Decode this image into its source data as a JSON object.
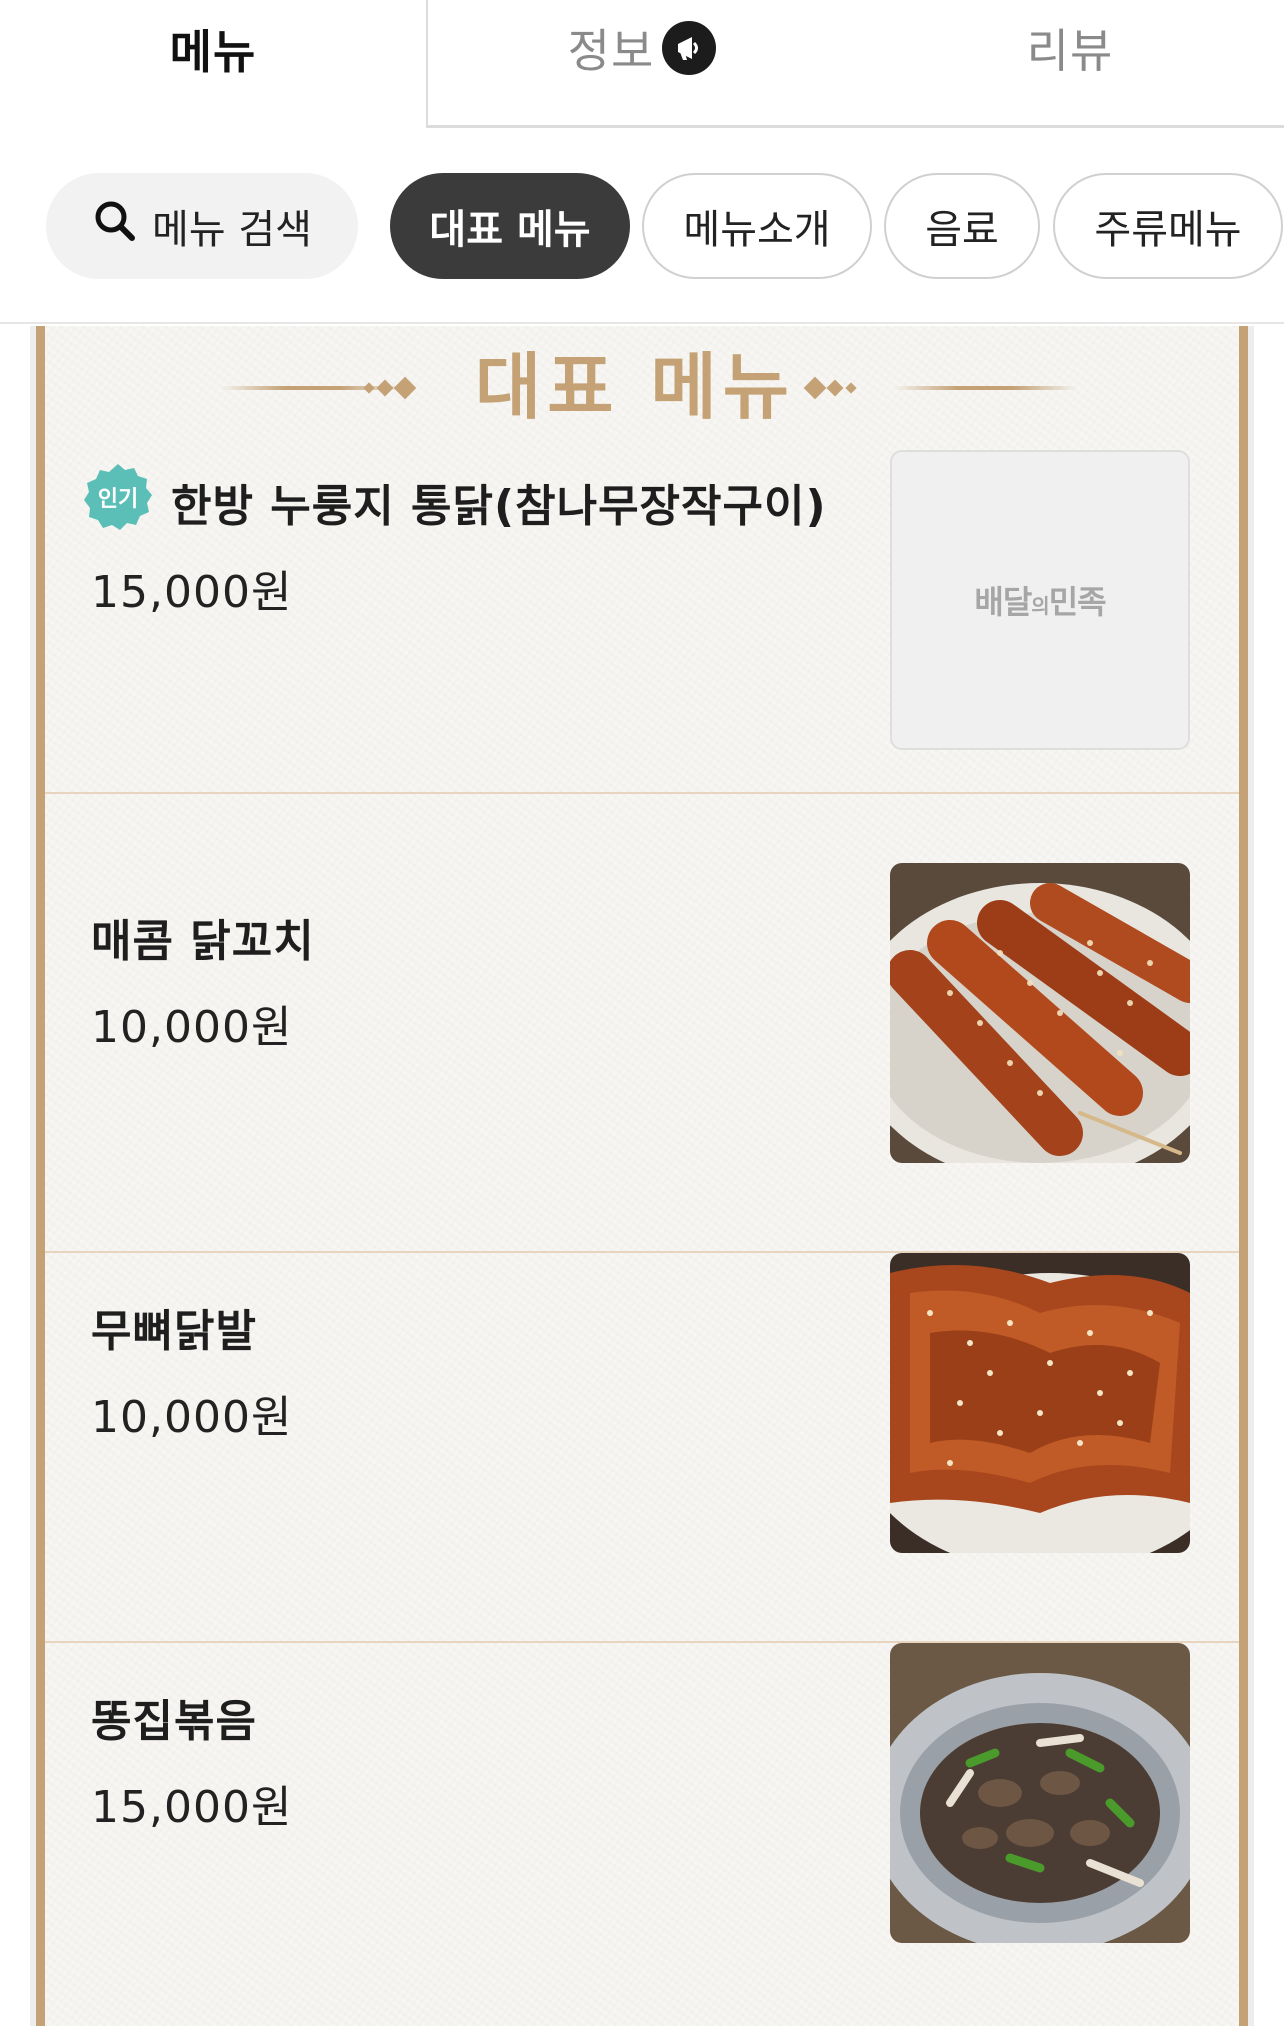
{
  "tabs": {
    "menu": "메뉴",
    "info": "정보",
    "review": "리뷰"
  },
  "chips": {
    "search": "메뉴 검색",
    "signature": "대표 메뉴",
    "intro": "메뉴소개",
    "drink": "음료",
    "alcohol": "주류메뉴"
  },
  "section": {
    "title": "대표 메뉴"
  },
  "items": [
    {
      "badge": "인기",
      "name": "한방 누룽지 통닭(참나무장작구이)",
      "price": "15,000원",
      "image": "placeholder"
    },
    {
      "name": "매콤 닭꼬치",
      "price": "10,000원",
      "image": "spicy-chicken-skewers"
    },
    {
      "name": "무뼈닭발",
      "price": "10,000원",
      "image": "boneless-chicken-feet"
    },
    {
      "name": "똥집볶음",
      "price": "15,000원",
      "image": "stir-fried-gizzards"
    }
  ],
  "placeholder_brand": {
    "left": "배달",
    "small": "의",
    "right": "민족"
  },
  "colors": {
    "accent": "#c4a276",
    "badge": "#5bbfb8",
    "chip_active": "#3b3b3b"
  }
}
